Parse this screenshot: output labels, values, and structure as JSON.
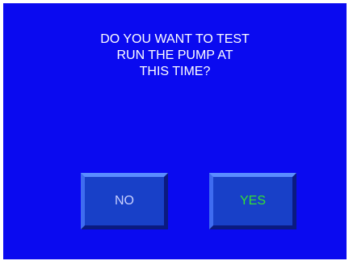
{
  "dialog": {
    "prompt_lines": [
      "DO YOU WANT TO TEST",
      "RUN THE PUMP AT",
      "THIS TIME?"
    ],
    "buttons": {
      "no": {
        "label": "NO",
        "color": "#c8d0ff"
      },
      "yes": {
        "label": "YES",
        "color": "#33e033"
      }
    },
    "panel_color": "#0a0af0",
    "button_color": "#1840c8"
  }
}
